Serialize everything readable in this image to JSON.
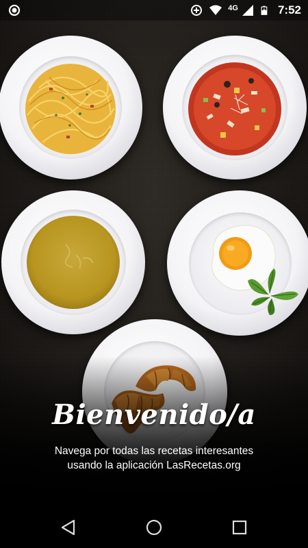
{
  "status_bar": {
    "left_icon": "notification-circle-icon",
    "icons": [
      "data-saver-icon",
      "wifi-icon",
      "signal-icon",
      "battery-charging-icon"
    ],
    "network_type": "4G",
    "time": "7:52"
  },
  "dishes": [
    {
      "name": "spaghetti-plate"
    },
    {
      "name": "vegetable-soup-plate"
    },
    {
      "name": "cream-soup-plate"
    },
    {
      "name": "fried-egg-plate"
    },
    {
      "name": "croissant-plate"
    }
  ],
  "welcome": {
    "title": "Bienvenido/a",
    "description": "Navega por todas las recetas interesantes usando la aplicación LasRecetas.org"
  },
  "nav_bar": {
    "icons": [
      "back-icon",
      "home-icon",
      "recent-apps-icon"
    ]
  },
  "colors": {
    "background": "#1a1714",
    "text": "#ffffff",
    "navbar": "#000000"
  }
}
